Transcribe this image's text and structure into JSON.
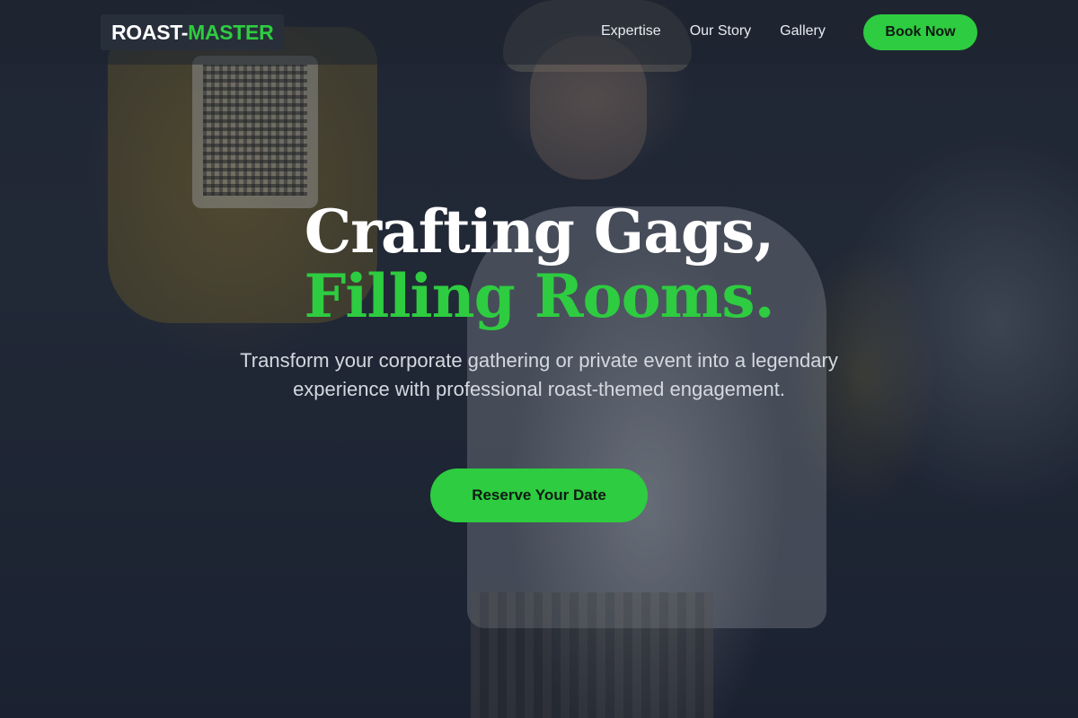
{
  "brand": {
    "part1": "ROAST-",
    "part2": "MASTER"
  },
  "nav": {
    "links": [
      "Expertise",
      "Our Story",
      "Gallery"
    ],
    "book_label": "Book Now"
  },
  "hero": {
    "headline_line1": "Crafting Gags,",
    "headline_line2": "Filling Rooms.",
    "subtitle": "Transform your corporate gathering or private event into a legendary experience with professional roast-themed engagement.",
    "cta_label": "Reserve Your Date"
  },
  "colors": {
    "accent": "#2ecc40",
    "nav_bg": "#1e2430",
    "text_light": "#d4d9e0"
  }
}
